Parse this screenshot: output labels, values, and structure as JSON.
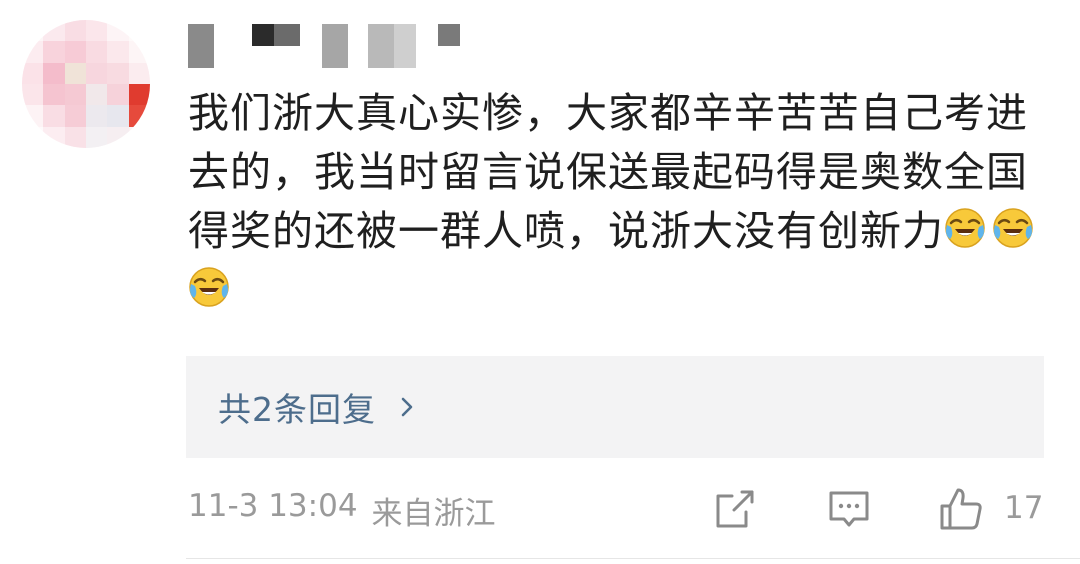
{
  "comment": {
    "text": "我们浙大真心实惨，大家都辛辛苦苦自己考进去的，我当时留言说保送最起码得是奥数全国得奖的还被一群人喷，说浙大没有创新力",
    "emojis": [
      "laughing-crying-emoji",
      "laughing-crying-emoji",
      "laughing-crying-emoji"
    ]
  },
  "replies": {
    "label": "共2条回复"
  },
  "meta": {
    "date": "11-3 13:04",
    "location": "来自浙江"
  },
  "actions": {
    "like_count": "17",
    "icons": [
      "share-icon",
      "comment-icon",
      "like-icon"
    ]
  },
  "colors": {
    "text": "#1f1f1f",
    "reply_link": "#4d6d8c",
    "meta": "#9a9a9a",
    "reply_bg": "#f3f3f4"
  }
}
